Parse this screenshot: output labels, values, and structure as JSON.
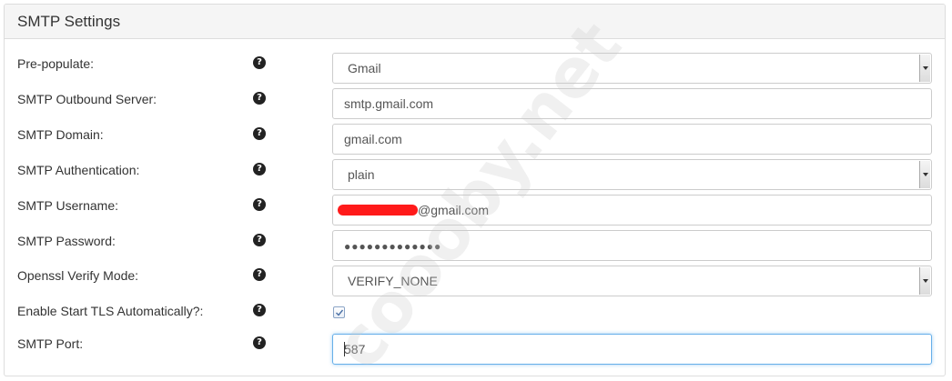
{
  "panel": {
    "title": "SMTP Settings"
  },
  "help_glyph": "?",
  "fields": {
    "prepopulate": {
      "label": "Pre-populate:",
      "value": "Gmail"
    },
    "outbound_server": {
      "label": "SMTP Outbound Server:",
      "value": "smtp.gmail.com"
    },
    "domain": {
      "label": "SMTP Domain:",
      "value": "gmail.com"
    },
    "authentication": {
      "label": "SMTP Authentication:",
      "value": "plain"
    },
    "username": {
      "label": "SMTP Username:",
      "value_suffix": "@gmail.com"
    },
    "password": {
      "label": "SMTP Password:",
      "value": "●●●●●●●●●●●●●"
    },
    "openssl_verify": {
      "label": "Openssl Verify Mode:",
      "value": "VERIFY_NONE"
    },
    "starttls": {
      "label": "Enable Start TLS Automatically?:",
      "checked": true
    },
    "port": {
      "label": "SMTP Port:",
      "value": "587"
    }
  },
  "watermark": {
    "text": "coooby.net"
  },
  "colors": {
    "focus_border": "#66afe9",
    "redaction": "#ff1a1a",
    "heading_bg": "#f5f5f5"
  }
}
